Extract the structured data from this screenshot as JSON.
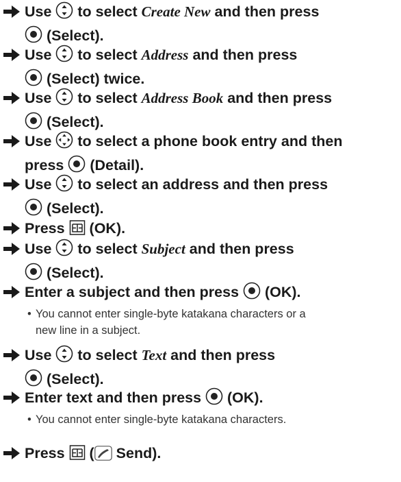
{
  "steps": [
    {
      "lines": [
        [
          {
            "t": "text",
            "v": "Use "
          },
          {
            "t": "icon",
            "icon": "nav-updown-icon"
          },
          {
            "t": "text",
            "v": " to select "
          },
          {
            "t": "em",
            "v": "Create New"
          },
          {
            "t": "text",
            "v": " and then press"
          }
        ],
        [
          {
            "t": "icon",
            "icon": "select-button-icon"
          },
          {
            "t": "text",
            "v": " (Select)."
          }
        ]
      ]
    },
    {
      "lines": [
        [
          {
            "t": "text",
            "v": "Use "
          },
          {
            "t": "icon",
            "icon": "nav-updown-icon"
          },
          {
            "t": "text",
            "v": " to select "
          },
          {
            "t": "em",
            "v": "Address"
          },
          {
            "t": "text",
            "v": " and then press"
          }
        ],
        [
          {
            "t": "icon",
            "icon": "select-button-icon"
          },
          {
            "t": "text",
            "v": " (Select) twice."
          }
        ]
      ]
    },
    {
      "lines": [
        [
          {
            "t": "text",
            "v": "Use "
          },
          {
            "t": "icon",
            "icon": "nav-updown-icon"
          },
          {
            "t": "text",
            "v": " to select "
          },
          {
            "t": "em",
            "v": "Address Book"
          },
          {
            "t": "text",
            "v": " and then press"
          }
        ],
        [
          {
            "t": "icon",
            "icon": "select-button-icon"
          },
          {
            "t": "text",
            "v": " (Select)."
          }
        ]
      ]
    },
    {
      "lines": [
        [
          {
            "t": "text",
            "v": "Use "
          },
          {
            "t": "icon",
            "icon": "nav-fourway-icon"
          },
          {
            "t": "text",
            "v": " to select a phone book entry and then"
          }
        ],
        [
          {
            "t": "text",
            "v": "press "
          },
          {
            "t": "icon",
            "icon": "select-button-icon"
          },
          {
            "t": "text",
            "v": " (Detail)."
          }
        ]
      ]
    },
    {
      "lines": [
        [
          {
            "t": "text",
            "v": "Use "
          },
          {
            "t": "icon",
            "icon": "nav-updown-icon"
          },
          {
            "t": "text",
            "v": " to select an address and then press"
          }
        ],
        [
          {
            "t": "icon",
            "icon": "select-button-icon"
          },
          {
            "t": "text",
            "v": " (Select)."
          }
        ]
      ]
    },
    {
      "lines": [
        [
          {
            "t": "text",
            "v": "Press "
          },
          {
            "t": "icon",
            "icon": "book-key-icon"
          },
          {
            "t": "text",
            "v": " (OK)."
          }
        ]
      ]
    },
    {
      "lines": [
        [
          {
            "t": "text",
            "v": "Use "
          },
          {
            "t": "icon",
            "icon": "nav-updown-icon"
          },
          {
            "t": "text",
            "v": " to select "
          },
          {
            "t": "em",
            "v": "Subject"
          },
          {
            "t": "text",
            "v": " and then press"
          }
        ],
        [
          {
            "t": "icon",
            "icon": "select-button-icon"
          },
          {
            "t": "text",
            "v": " (Select)."
          }
        ]
      ]
    },
    {
      "lines": [
        [
          {
            "t": "text",
            "v": "Enter a subject and then press "
          },
          {
            "t": "icon",
            "icon": "select-button-icon"
          },
          {
            "t": "text",
            "v": " (OK)."
          }
        ]
      ],
      "notes": [
        {
          "lines": [
            "You cannot enter single-byte katakana characters or a",
            "new line in a subject."
          ]
        }
      ]
    },
    {
      "lines": [
        [
          {
            "t": "text",
            "v": "Use "
          },
          {
            "t": "icon",
            "icon": "nav-updown-icon"
          },
          {
            "t": "text",
            "v": " to select "
          },
          {
            "t": "em",
            "v": "Text"
          },
          {
            "t": "text",
            "v": " and then press"
          }
        ],
        [
          {
            "t": "icon",
            "icon": "select-button-icon"
          },
          {
            "t": "text",
            "v": " (Select)."
          }
        ]
      ]
    },
    {
      "lines": [
        [
          {
            "t": "text",
            "v": "Enter text and then press "
          },
          {
            "t": "icon",
            "icon": "select-button-icon"
          },
          {
            "t": "text",
            "v": " (OK)."
          }
        ]
      ],
      "notes": [
        {
          "lines": [
            "You cannot enter single-byte katakana characters."
          ]
        }
      ]
    },
    {
      "lines": [
        [
          {
            "t": "text",
            "v": "Press "
          },
          {
            "t": "icon",
            "icon": "book-key-icon"
          },
          {
            "t": "text",
            "v": " ("
          },
          {
            "t": "icon",
            "icon": "send-mail-icon"
          },
          {
            "t": "text",
            "v": " Send)."
          }
        ]
      ]
    }
  ],
  "bullet_char": "•",
  "colors": {
    "text": "#1a1a1a",
    "note": "#333333",
    "icon": "#222222"
  }
}
